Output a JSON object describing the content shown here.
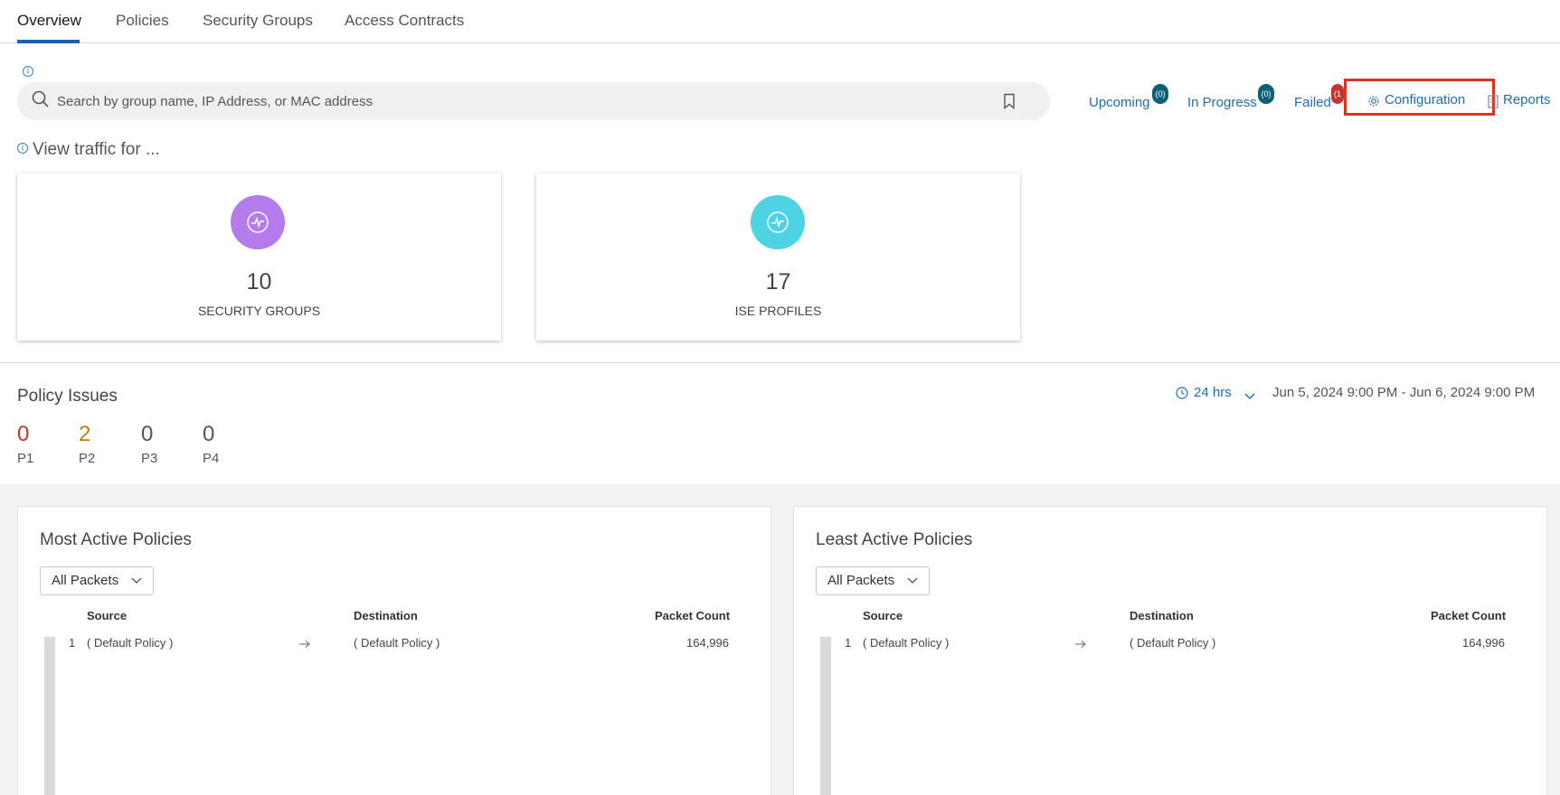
{
  "tabs": [
    {
      "label": "Overview",
      "active": true
    },
    {
      "label": "Policies",
      "active": false
    },
    {
      "label": "Security Groups",
      "active": false
    },
    {
      "label": "Access Contracts",
      "active": false
    }
  ],
  "search": {
    "placeholder": "Search by group name, IP Address, or MAC address"
  },
  "status": {
    "upcoming": {
      "label": "Upcoming",
      "count": "(0)"
    },
    "in_progress": {
      "label": "In Progress",
      "count": "(0)"
    },
    "failed": {
      "label": "Failed",
      "count": "(1"
    },
    "configuration": "Configuration",
    "reports": "Reports"
  },
  "view_traffic": "View traffic for ...",
  "cards": [
    {
      "value": "10",
      "label": "SECURITY GROUPS",
      "color": "#b57bed"
    },
    {
      "value": "17",
      "label": "ISE PROFILES",
      "color": "#4dd3e3"
    }
  ],
  "policy_issues": {
    "title": "Policy Issues",
    "time_range": "24 hrs",
    "date_range": "Jun 5, 2024 9:00 PM - Jun 6, 2024 9:00 PM",
    "priorities": [
      {
        "label": "P1",
        "value": "0",
        "color": "#c7362e"
      },
      {
        "label": "P2",
        "value": "2",
        "color": "#c47c0f"
      },
      {
        "label": "P3",
        "value": "0",
        "color": "#555555"
      },
      {
        "label": "P4",
        "value": "0",
        "color": "#555555"
      }
    ]
  },
  "panels": [
    {
      "title": "Most Active Policies",
      "filter": "All Packets",
      "columns": {
        "source": "Source",
        "destination": "Destination",
        "packet_count": "Packet Count"
      },
      "rows": [
        {
          "index": "1",
          "source": "( Default Policy )",
          "destination": "( Default Policy )",
          "packet_count": "164,996"
        }
      ]
    },
    {
      "title": "Least Active Policies",
      "filter": "All Packets",
      "columns": {
        "source": "Source",
        "destination": "Destination",
        "packet_count": "Packet Count"
      },
      "rows": [
        {
          "index": "1",
          "source": "( Default Policy )",
          "destination": "( Default Policy )",
          "packet_count": "164,996"
        }
      ]
    }
  ]
}
